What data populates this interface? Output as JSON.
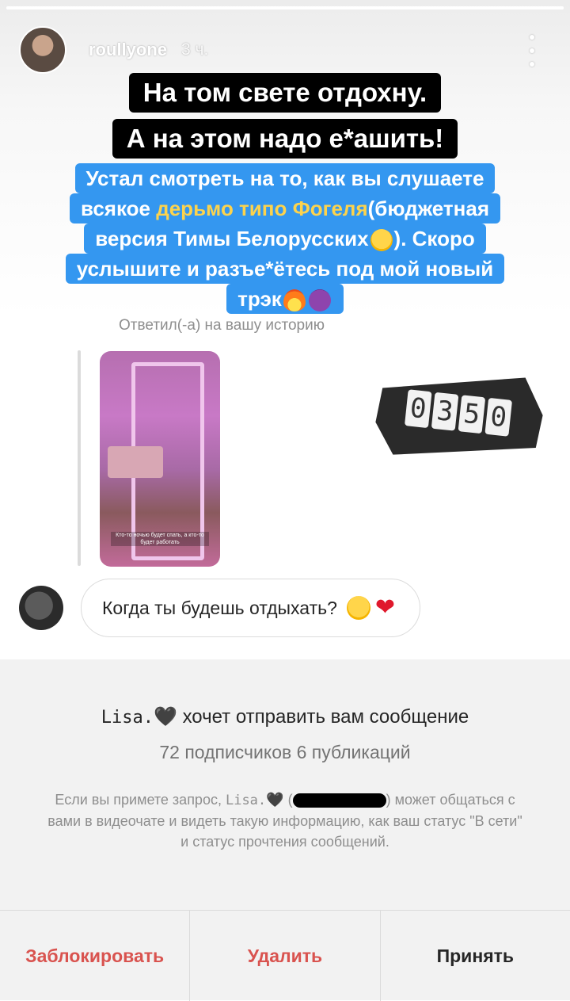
{
  "story": {
    "username": "roullyone",
    "time": "3 ч.",
    "progress": 1.0,
    "caption_black": [
      "На том свете отдохну.",
      "А на этом надо е*ашить!"
    ],
    "caption_blue": {
      "line1": "Устал смотреть на то, как вы слушаете",
      "line2_a": "всякое ",
      "line2_highlight": "дерьмо типо Фогеля",
      "line2_b": "(бюджетная",
      "line3_a": "версия Тимы Белорусских",
      "line3_b": "). Скоро",
      "line4": "услышите и разъе*ётесь под мой новый",
      "line5": "трэк"
    },
    "replied_label": "Ответил(-а) на вашу историю",
    "thumb_text": "Кто-то ночью будет спать, а кто-то будет работать",
    "clock_digits": [
      "0",
      "3",
      "5",
      "0"
    ]
  },
  "message": {
    "text": "Когда ты будешь отдыхать?",
    "heart": "❤"
  },
  "request": {
    "sender": "Lisa.",
    "heart": "🖤",
    "title_rest": "хочет отправить вам сообщение",
    "stats": "72 подписчиков 6 публикаций",
    "info_a": "Если вы примете запрос, ",
    "info_sender": "Lisa.",
    "info_b": "может общаться с вами в видеочате и видеть такую информацию, как ваш статус \"В сети\" и статус прочтения сообщений."
  },
  "actions": {
    "block": "Заблокировать",
    "delete": "Удалить",
    "accept": "Принять"
  }
}
